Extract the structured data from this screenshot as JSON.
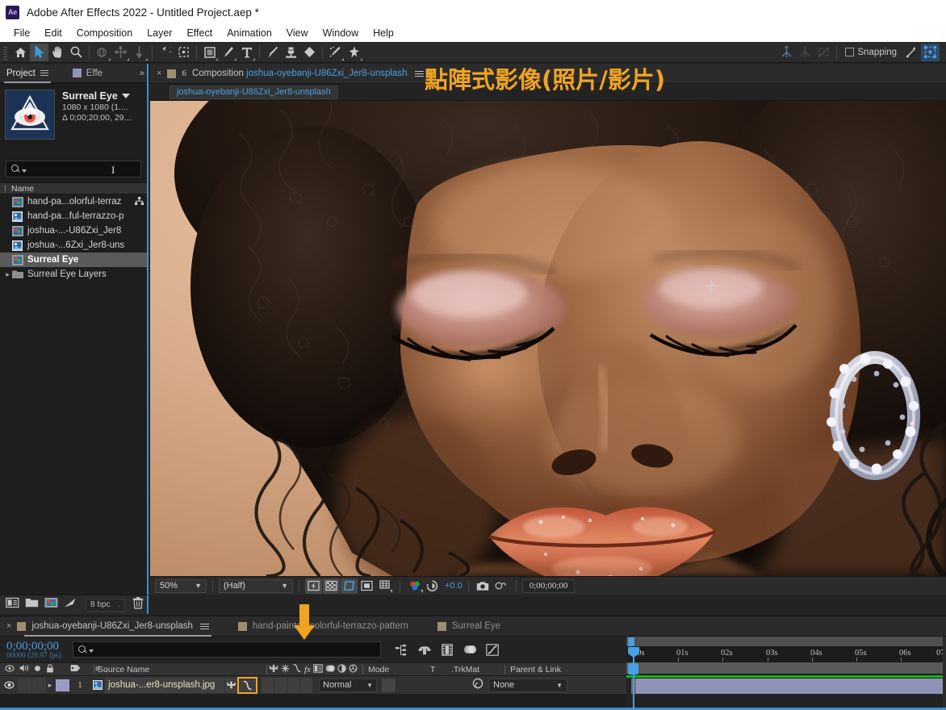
{
  "window": {
    "app_logo": "Ae",
    "title": "Adobe After Effects 2022 - Untitled Project.aep *"
  },
  "menubar": {
    "items": [
      "File",
      "Edit",
      "Composition",
      "Layer",
      "Effect",
      "Animation",
      "View",
      "Window",
      "Help"
    ]
  },
  "toolbar": {
    "snapping_label": "Snapping",
    "tools": [
      "home-icon",
      "selection-tool-icon",
      "hand-tool-icon",
      "zoom-tool-icon",
      "orbit-tool-icon",
      "pan-tool-icon",
      "dolly-tool-icon",
      "rotation-tool-icon",
      "anchor-point-tool-icon",
      "shape-tool-icon",
      "pen-tool-icon",
      "type-tool-icon",
      "brush-tool-icon",
      "clone-stamp-tool-icon",
      "eraser-tool-icon",
      "roto-brush-tool-icon",
      "puppet-pin-tool-icon"
    ]
  },
  "project_panel": {
    "tabs": [
      {
        "label": "Project",
        "selected": true
      },
      {
        "label": "Effe",
        "selected": false
      }
    ],
    "more_chevron": "»",
    "selected_item": {
      "name": "Surreal Eye",
      "dimensions": "1080 x 1080 (1....",
      "duration": "Δ 0;00;20;00, 29…"
    },
    "search_placeholder": "",
    "column_header": "Name",
    "items": [
      {
        "label": "hand-pa...olorful-terraz",
        "icon": "footage-icon",
        "expandable": false,
        "selected": false,
        "shared": true
      },
      {
        "label": "hand-pa...ful-terrazzo-p",
        "icon": "still-image-icon",
        "expandable": false,
        "selected": false,
        "shared": false
      },
      {
        "label": "joshua-...-U86Zxi_Jer8",
        "icon": "footage-icon",
        "expandable": false,
        "selected": false,
        "shared": false
      },
      {
        "label": "joshua-...6Zxi_Jer8-uns",
        "icon": "still-image-icon",
        "expandable": false,
        "selected": false,
        "shared": false
      },
      {
        "label": "Surreal Eye",
        "icon": "composition-icon",
        "expandable": false,
        "selected": true,
        "shared": false
      },
      {
        "label": "Surreal Eye Layers",
        "icon": "folder-icon",
        "expandable": true,
        "selected": false,
        "shared": false
      }
    ],
    "footer": {
      "bit_depth": "8 bpc",
      "buttons": [
        "interpret-footage-icon",
        "new-folder-icon",
        "new-composition-icon",
        "project-settings-icon",
        "delete-icon"
      ]
    }
  },
  "composition_panel": {
    "close_label": "×",
    "fps_badge": "6",
    "tab_prefix": "Composition",
    "tab_comp_name": "joshua-oyebanji-U86Zxi_Jer8-unsplash",
    "sub_tab": "joshua-oyebanji-U86Zxi_Jer8-unsplash",
    "overlay_text": "點陣式影像(照片/影片)",
    "overlay_color": "#f0a422",
    "bottom_bar": {
      "zoom_level": "50%",
      "resolution": "(Half)",
      "exposure": "+0.0",
      "timecode": "0;00;00;00",
      "toggles": [
        "fast-previews-icon",
        "transparency-grid-icon",
        "region-of-interest-icon",
        "title-action-safe-icon",
        "grid-guides-icon",
        "channel-rgb-icon",
        "reset-exposure-icon",
        "snapshot-icon",
        "show-snapshot-icon"
      ]
    }
  },
  "timeline_panel": {
    "tabs": [
      {
        "label": "joshua-oyebanji-U86Zxi_Jer8-unsplash",
        "selected": true
      },
      {
        "label": "hand-painted-colorful-terrazzo-pattern",
        "selected": false
      },
      {
        "label": "Surreal Eye",
        "selected": false
      }
    ],
    "timecode": "0;00;00;00",
    "frame_info": "00000 (29.97 fps)",
    "search_placeholder": "",
    "toolbar_icons": [
      "composition-mini-flowchart-icon",
      "draft-3d-icon",
      "hide-shy-layers-icon",
      "frame-blending-icon",
      "motion-blur-icon",
      "graph-editor-icon"
    ],
    "columns": {
      "av_features": [
        "eye-icon",
        "audio-icon",
        "solo-icon",
        "lock-icon"
      ],
      "label": "label-tag-icon",
      "number": "#",
      "source_name": "Source Name",
      "switches": [
        "audio-enable-icon",
        "shy-icon",
        "continuously-rasterize-icon",
        "fx-effects-icon",
        "frame-blend-icon",
        "motion-blur-icon",
        "adjustment-layer-icon",
        "3d-layer-icon"
      ],
      "mode": "Mode",
      "t": "T",
      "trkmat": ".TrkMat",
      "parent_link": "Parent & Link"
    },
    "layers": [
      {
        "index": "1",
        "name": "joshua-...er8-unsplash.jpg",
        "mode": "Normal",
        "parent": "None",
        "visible": true,
        "rasterize_highlighted": true,
        "highlight_color": "#f0a422",
        "bar_color": "#9b9dc4"
      }
    ],
    "ruler_ticks": [
      "00s",
      "01s",
      "02s",
      "03s",
      "04s",
      "05s",
      "06s",
      "07"
    ]
  }
}
